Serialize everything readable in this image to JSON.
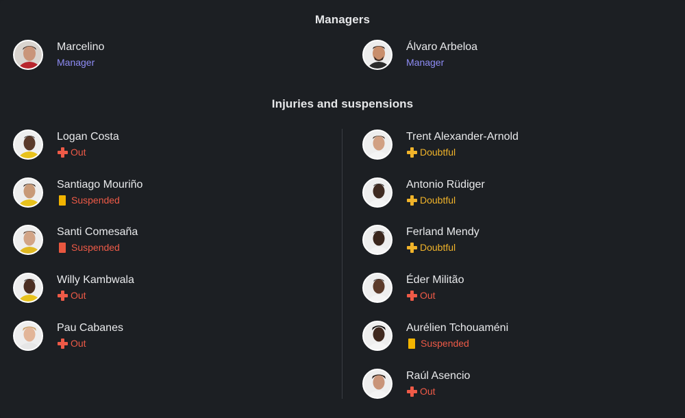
{
  "sections": {
    "managers_title": "Managers",
    "injuries_title": "Injuries and suspensions"
  },
  "managers": [
    {
      "name": "Marcelino",
      "role": "Manager"
    },
    {
      "name": "Álvaro Arbeloa",
      "role": "Manager"
    }
  ],
  "injuries_left": [
    {
      "name": "Logan Costa",
      "status": "Out",
      "status_icon": "cross-icon"
    },
    {
      "name": "Santiago Mouriño",
      "status": "Suspended",
      "status_icon": "yellow-card-icon"
    },
    {
      "name": "Santi Comesaña",
      "status": "Suspended",
      "status_icon": "red-card-icon"
    },
    {
      "name": "Willy Kambwala",
      "status": "Out",
      "status_icon": "cross-icon"
    },
    {
      "name": "Pau Cabanes",
      "status": "Out",
      "status_icon": "cross-icon"
    }
  ],
  "injuries_right": [
    {
      "name": "Trent Alexander-Arnold",
      "status": "Doubtful",
      "status_icon": "cross-icon"
    },
    {
      "name": "Antonio Rüdiger",
      "status": "Doubtful",
      "status_icon": "cross-icon"
    },
    {
      "name": "Ferland Mendy",
      "status": "Doubtful",
      "status_icon": "cross-icon"
    },
    {
      "name": "Éder Militão",
      "status": "Out",
      "status_icon": "cross-icon"
    },
    {
      "name": "Aurélien Tchouaméni",
      "status": "Suspended",
      "status_icon": "yellow-card-icon"
    },
    {
      "name": "Raúl Asencio",
      "status": "Out",
      "status_icon": "cross-icon"
    }
  ],
  "colors": {
    "background": "#1c1f23",
    "manager_role": "#8e8cf5",
    "out": "#ee5a47",
    "doubtful": "#f0b32a",
    "yellow_card": "#f2b400",
    "red_card": "#e9573f"
  }
}
